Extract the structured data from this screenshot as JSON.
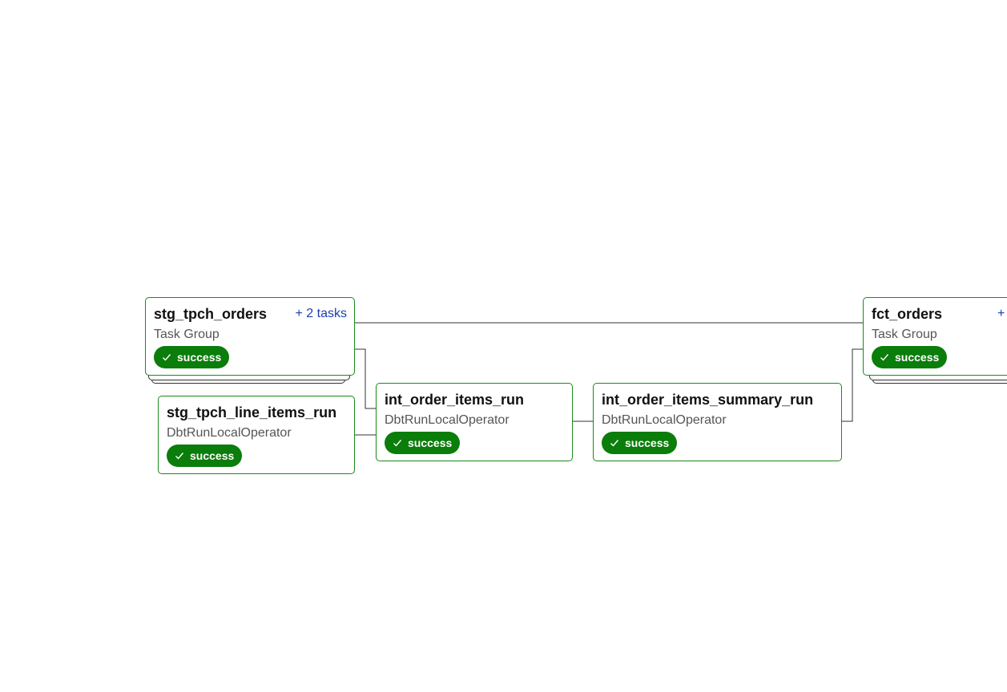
{
  "colors": {
    "node_border": "#1a8a1a",
    "success_badge": "#0a7d0a",
    "edge": "#333333",
    "link": "#1a3fb0"
  },
  "nodes": {
    "stg_tpch_orders": {
      "title": "stg_tpch_orders",
      "subtitle": "Task Group",
      "tasks_link": "+ 2 tasks",
      "status": "success",
      "status_icon": "check-icon"
    },
    "stg_tpch_line_items_run": {
      "title": "stg_tpch_line_items_run",
      "subtitle": "DbtRunLocalOperator",
      "status": "success",
      "status_icon": "check-icon"
    },
    "int_order_items_run": {
      "title": "int_order_items_run",
      "subtitle": "DbtRunLocalOperator",
      "status": "success",
      "status_icon": "check-icon"
    },
    "int_order_items_summary_run": {
      "title": "int_order_items_summary_run",
      "subtitle": "DbtRunLocalOperator",
      "status": "success",
      "status_icon": "check-icon"
    },
    "fct_orders": {
      "title": "fct_orders",
      "subtitle": "Task Group",
      "tasks_link": "+",
      "status": "success",
      "status_icon": "check-icon"
    }
  }
}
